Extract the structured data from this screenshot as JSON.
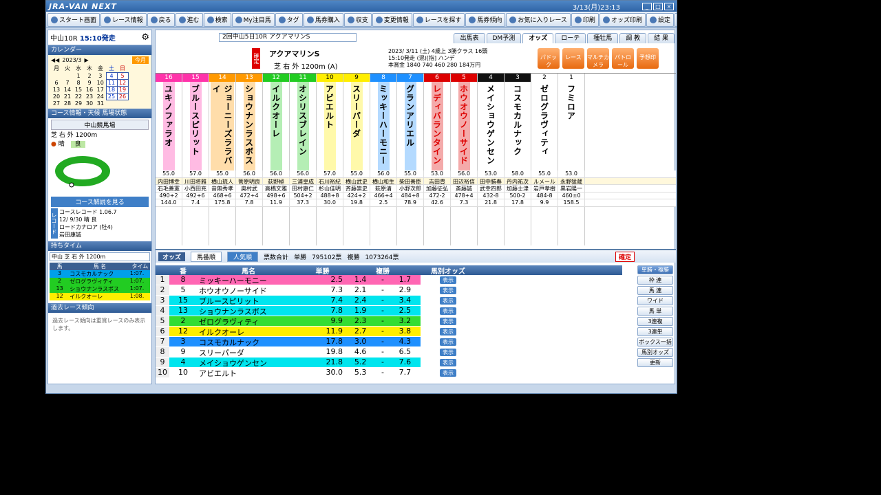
{
  "titlebar": {
    "app": "JRA-VAN NEXT",
    "clock": "3/13(月)23:13"
  },
  "toolbar": [
    "スタート画面",
    "レース情報",
    "戻る",
    "進む",
    "検索",
    "My注目馬",
    "タグ",
    "馬券購入",
    "収支",
    "変更情報",
    "レースを探す",
    "馬券傾向",
    "お気に入りレース",
    "印刷",
    "オッズ印刷",
    "設定",
    "ヘルプ"
  ],
  "left": {
    "race_label": "中山10R",
    "start": "15:10発走",
    "calendar_head": "カレンダー",
    "month": "2023/3",
    "today_btn": "今月",
    "weekdays": [
      "月",
      "火",
      "水",
      "木",
      "金",
      "土",
      "日"
    ],
    "weeks": [
      [
        "",
        "",
        "1",
        "2",
        "3",
        "4",
        "5"
      ],
      [
        "6",
        "7",
        "8",
        "9",
        "10",
        "11",
        "12"
      ],
      [
        "13",
        "14",
        "15",
        "16",
        "17",
        "18",
        "19"
      ],
      [
        "20",
        "21",
        "22",
        "23",
        "24",
        "25",
        "26"
      ],
      [
        "27",
        "28",
        "29",
        "30",
        "31",
        "",
        ""
      ]
    ],
    "course_head": "コース情報・天候 馬場状態",
    "venue": "中山競馬場",
    "course": "芝 右 外 1200m",
    "weather": "晴",
    "going": "良",
    "course_btn": "コース解説を見る",
    "record": {
      "label": "コースレコード",
      "time": "1.06.7",
      "date": "12/ 9/30 晴 良",
      "horse": "ロードカナロア (牡4)",
      "jockey": "岩田康誠"
    },
    "time_head": "持ちタイム",
    "time_sel": "中山 芝 右 外 1200m",
    "time_cols": [
      "馬",
      "馬 名",
      "タイム"
    ],
    "times": [
      {
        "no": "3",
        "name": "コスモカルナック",
        "t": "1:07.",
        "c": "#00a0e9"
      },
      {
        "no": "2",
        "name": "ゼログラヴィティ",
        "t": "1:07.",
        "c": "#22cc22"
      },
      {
        "no": "13",
        "name": "ショウナンラスボス",
        "t": "1:07.",
        "c": "#22cc22"
      },
      {
        "no": "12",
        "name": "イルクオーレ",
        "t": "1:08.",
        "c": "#ffee00"
      }
    ],
    "past_head": "過去レース傾向",
    "past_note": "過去レース傾向は重賞レースのみ表示します。"
  },
  "tabs": [
    "出馬表",
    "DM予測",
    "オッズ",
    "ローテ",
    "種牡馬",
    "調 教",
    "結 果"
  ],
  "race": {
    "label": "2回中山5日10R アクアマリンS",
    "status": "確定",
    "name": "アクアマリンS",
    "detail": "芝 右 外 1200m (A)",
    "weather": "晴",
    "going": "良",
    "date": "2023/ 3/11 (土) 4歳上 3勝クラス 16頭",
    "time": "15:10発走 (混)[指] ハンデ",
    "prize": "本賞金 1840 740 460 280 184万円",
    "btns": [
      "パドック",
      "レース",
      "マルチカメラ",
      "パトロール",
      "予想印"
    ]
  },
  "horses": [
    {
      "g": "8",
      "no": "16",
      "name": "ユキノファラオ",
      "c": "#ff33aa",
      "gc": "#ff33aa"
    },
    {
      "g": "8",
      "no": "15",
      "name": "ブルースピリット",
      "c": "#ff33aa",
      "gc": "#ff33aa"
    },
    {
      "g": "7",
      "no": "14",
      "name": "ジョーニーズララバイ",
      "c": "#ff9900",
      "gc": "#ff9900"
    },
    {
      "g": "7",
      "no": "13",
      "name": "ショウナンラスボス",
      "c": "#ff9900",
      "gc": "#ff9900"
    },
    {
      "g": "6",
      "no": "12",
      "name": "イルクオーレ",
      "c": "#22cc22",
      "gc": "#22cc22"
    },
    {
      "g": "6",
      "no": "11",
      "name": "オシリスブレイン",
      "c": "#22cc22",
      "gc": "#22cc22"
    },
    {
      "g": "5",
      "no": "10",
      "name": "アビエルト",
      "c": "#ffee00",
      "gc": "#ffee00"
    },
    {
      "g": "5",
      "no": "9",
      "name": "スリーパーダ",
      "c": "#ffee00",
      "gc": "#ffee00"
    },
    {
      "g": "4",
      "no": "8",
      "name": "ミッキーハーモニー",
      "c": "#1e90ff",
      "gc": "#1e90ff"
    },
    {
      "g": "4",
      "no": "7",
      "name": "グランアリエル",
      "c": "#1e90ff",
      "gc": "#1e90ff"
    },
    {
      "g": "3",
      "no": "6",
      "name": "レディバランタイン",
      "c": "#dd0000",
      "gc": "#dd0000"
    },
    {
      "g": "3",
      "no": "5",
      "name": "ホウオウノーサイド",
      "c": "#dd0000",
      "gc": "#dd0000"
    },
    {
      "g": "2",
      "no": "4",
      "name": "メイショウゲンセン",
      "c": "#111111",
      "gc": "#111111"
    },
    {
      "g": "2",
      "no": "3",
      "name": "コスモカルナック",
      "c": "#111111",
      "gc": "#111111"
    },
    {
      "g": "1",
      "no": "2",
      "name": "ゼログラヴィティ",
      "c": "#ffffff",
      "gc": "#ffffff"
    },
    {
      "g": "1",
      "no": "1",
      "name": "フミロア",
      "c": "#ffffff",
      "gc": "#ffffff"
    }
  ],
  "weights": [
    "55.0",
    "57.0",
    "55.0",
    "56.0",
    "56.0",
    "56.0",
    "57.0",
    "55.0",
    "56.0",
    "55.0",
    "53.0",
    "56.0",
    "53.0",
    "58.0",
    "55.0",
    "53.0"
  ],
  "jockeys": [
    "内田博幸",
    "川田将雅",
    "横山琉人",
    "菅原明良",
    "荻野極",
    "三浦皇成",
    "石川裕紀",
    "横山武史",
    "横山和生",
    "柴田善臣",
    "吉田豊",
    "田辺裕信",
    "田中勝春",
    "丹内祐次",
    "ルメール",
    "永野猛蔵"
  ],
  "trainers": [
    "石毛善憲",
    "小西田充",
    "音無秀孝",
    "奥村武",
    "高橋文雅",
    "田村康仁",
    "杉山佳明",
    "斉藤崇史",
    "萩原清",
    "小野次郎",
    "加藤征弘",
    "斎藤誠",
    "武幸四郎",
    "加藤士津",
    "岩戸孝樹",
    "黒岩陽一"
  ],
  "bodyw": [
    "490+2",
    "492+6",
    "468+6",
    "472+4",
    "498+6",
    "504+2",
    "488+8",
    "424+2",
    "466+4",
    "484+8",
    "472-2",
    "478+4",
    "432-8",
    "500-2",
    "484-8",
    "460±0"
  ],
  "win_odds_row": [
    "144.0",
    "7.4",
    "175.8",
    "7.8",
    "11.9",
    "37.3",
    "30.0",
    "19.8",
    "2.5",
    "78.9",
    "42.6",
    "7.3",
    "21.8",
    "17.8",
    "9.9",
    "158.5"
  ],
  "odds_section": {
    "title": "オッズ",
    "tab1": "馬番順",
    "tab2": "人気順",
    "total_label": "票数合計",
    "win_label": "単勝",
    "win_votes": "795102票",
    "place_label": "複勝",
    "place_votes": "1073264票",
    "confirm": "確定"
  },
  "odds_cols": [
    "番",
    "馬名",
    "単勝",
    "複勝",
    "馬別オッズ"
  ],
  "odds_rows": [
    {
      "rank": "1",
      "no": "8",
      "name": "ミッキーハーモニー",
      "win": "2.5",
      "p1": "1.4",
      "p2": "1.7",
      "c": "#ff66b3"
    },
    {
      "rank": "2",
      "no": "5",
      "name": "ホウオウノーサイド",
      "win": "7.3",
      "p1": "2.1",
      "p2": "2.9",
      "c": "#ffffff"
    },
    {
      "rank": "3",
      "no": "15",
      "name": "ブルースピリット",
      "win": "7.4",
      "p1": "2.4",
      "p2": "3.4",
      "c": "#00e5ee"
    },
    {
      "rank": "4",
      "no": "13",
      "name": "ショウナンラスボス",
      "win": "7.8",
      "p1": "1.9",
      "p2": "2.5",
      "c": "#00e5ee"
    },
    {
      "rank": "5",
      "no": "2",
      "name": "ゼログラヴィティ",
      "win": "9.9",
      "p1": "2.3",
      "p2": "3.2",
      "c": "#33dd33"
    },
    {
      "rank": "6",
      "no": "12",
      "name": "イルクオーレ",
      "win": "11.9",
      "p1": "2.7",
      "p2": "3.8",
      "c": "#ffee00"
    },
    {
      "rank": "7",
      "no": "3",
      "name": "コスモカルナック",
      "win": "17.8",
      "p1": "3.0",
      "p2": "4.3",
      "c": "#1e90ff"
    },
    {
      "rank": "8",
      "no": "9",
      "name": "スリーパーダ",
      "win": "19.8",
      "p1": "4.6",
      "p2": "6.5",
      "c": "#ffffff"
    },
    {
      "rank": "9",
      "no": "4",
      "name": "メイショウゲンセン",
      "win": "21.8",
      "p1": "5.2",
      "p2": "7.6",
      "c": "#00e5ee"
    },
    {
      "rank": "10",
      "no": "10",
      "name": "アビエルト",
      "win": "30.0",
      "p1": "5.3",
      "p2": "7.7",
      "c": "#ffffff"
    }
  ],
  "show_label": "表示",
  "right_btns": [
    "単勝・複勝",
    "枠 連",
    "馬 連",
    "ワイド",
    "馬 単",
    "3連複",
    "3連単",
    "ボックス一括",
    "馬別オッズ",
    "更新"
  ]
}
